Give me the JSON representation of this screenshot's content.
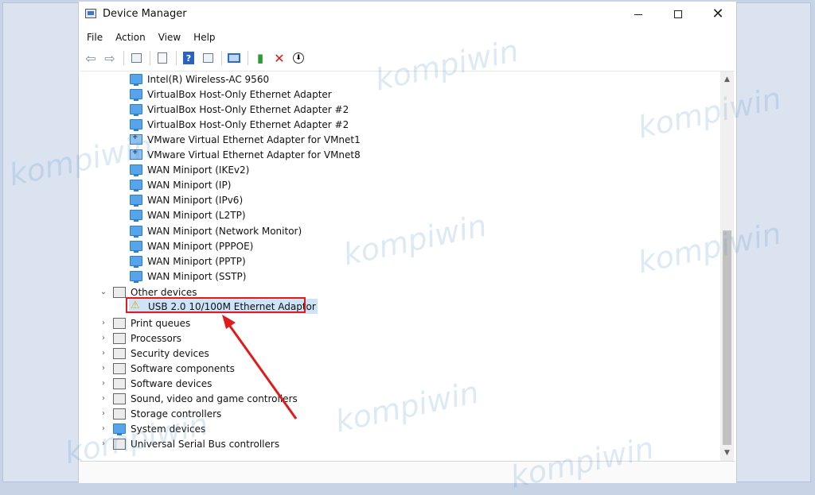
{
  "window": {
    "title": "Device Manager",
    "controls": {
      "minimize": "—",
      "maximize": "□",
      "close": "✕"
    }
  },
  "menu": [
    "File",
    "Action",
    "View",
    "Help"
  ],
  "toolbar": {
    "icons": [
      "back-icon",
      "forward-icon",
      "properties-icon",
      "document-icon",
      "help-icon",
      "grid-icon",
      "monitor-icon",
      "update-driver-icon",
      "uninstall-icon",
      "download-icon"
    ]
  },
  "tree": {
    "network_adapters": [
      {
        "label": "Intel(R) Wireless-AC 9560",
        "icon": "network-adapter-icon"
      },
      {
        "label": "VirtualBox Host-Only Ethernet Adapter",
        "icon": "network-adapter-icon"
      },
      {
        "label": "VirtualBox Host-Only Ethernet Adapter #2",
        "icon": "network-adapter-icon"
      },
      {
        "label": "VirtualBox Host-Only Ethernet Adapter #2",
        "icon": "network-adapter-icon"
      },
      {
        "label": "VMware Virtual Ethernet Adapter for VMnet1",
        "icon": "vmware-adapter-icon"
      },
      {
        "label": "VMware Virtual Ethernet Adapter for VMnet8",
        "icon": "vmware-adapter-icon"
      },
      {
        "label": "WAN Miniport (IKEv2)",
        "icon": "network-adapter-icon"
      },
      {
        "label": "WAN Miniport (IP)",
        "icon": "network-adapter-icon"
      },
      {
        "label": "WAN Miniport (IPv6)",
        "icon": "network-adapter-icon"
      },
      {
        "label": "WAN Miniport (L2TP)",
        "icon": "network-adapter-icon"
      },
      {
        "label": "WAN Miniport (Network Monitor)",
        "icon": "network-adapter-icon"
      },
      {
        "label": "WAN Miniport (PPPOE)",
        "icon": "network-adapter-icon"
      },
      {
        "label": "WAN Miniport (PPTP)",
        "icon": "network-adapter-icon"
      },
      {
        "label": "WAN Miniport (SSTP)",
        "icon": "network-adapter-icon"
      }
    ],
    "other_devices": {
      "label": "Other devices",
      "expander": "⌄",
      "children": [
        {
          "label": "USB 2.0 10/100M Ethernet Adaptor",
          "icon": "warning-icon"
        }
      ]
    },
    "categories": [
      {
        "label": "Print queues",
        "expander": "›"
      },
      {
        "label": "Processors",
        "expander": "›"
      },
      {
        "label": "Security devices",
        "expander": "›"
      },
      {
        "label": "Software components",
        "expander": "›"
      },
      {
        "label": "Software devices",
        "expander": "›"
      },
      {
        "label": "Sound, video and game controllers",
        "expander": "›"
      },
      {
        "label": "Storage controllers",
        "expander": "›"
      },
      {
        "label": "System devices",
        "expander": "›"
      },
      {
        "label": "Universal Serial Bus controllers",
        "expander": "›"
      }
    ]
  },
  "scrollbar": {
    "up": "▲",
    "down": "▼"
  },
  "watermark": "kompiwin",
  "colors": {
    "annotation": "#e01b1b",
    "watermark": "#5096c8"
  }
}
